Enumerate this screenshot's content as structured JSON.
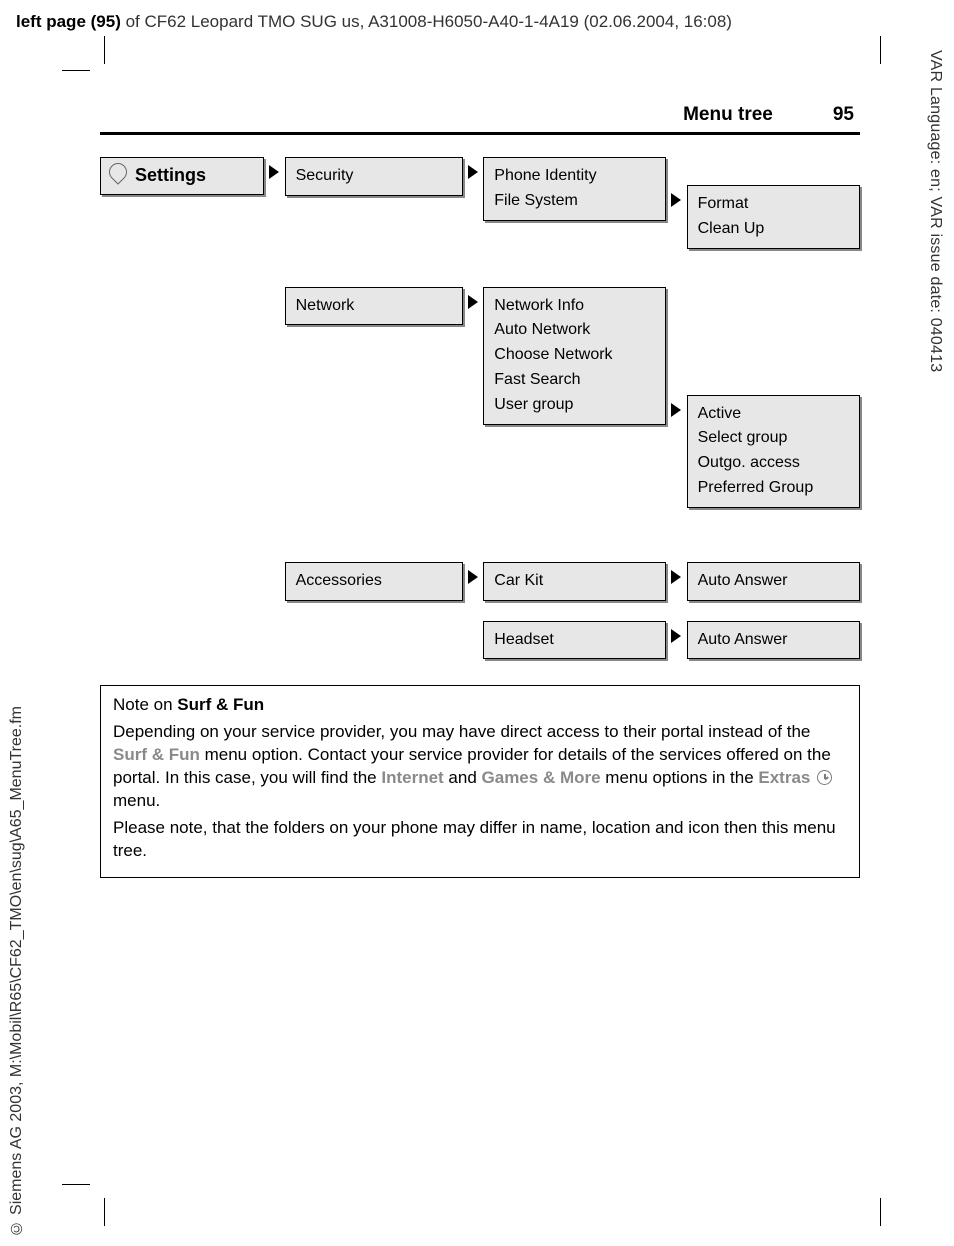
{
  "header": {
    "prefix": "left page (95)",
    "rest": " of CF62 Leopard TMO SUG us, A31008-H6050-A40-1-4A19 (02.06.2004, 16:08)"
  },
  "side_right": "VAR Language: en; VAR issue date: 040413",
  "side_left": "© Siemens AG 2003, M:\\Mobil\\R65\\CF62_TMO\\en\\sug\\A65_MenuTree.fm",
  "running_head": {
    "title": "Menu tree",
    "page": "95"
  },
  "tree": {
    "root": "Settings",
    "security": {
      "label": "Security",
      "children": {
        "phone_identity": "Phone Identity",
        "file_system": "File System"
      },
      "file_system_children": {
        "format": "Format",
        "clean_up": "Clean Up"
      }
    },
    "network": {
      "label": "Network",
      "children": {
        "network_info": "Network Info",
        "auto_network": "Auto Network",
        "choose_network": "Choose Network",
        "fast_search": "Fast Search",
        "user_group": "User group"
      },
      "user_group_children": {
        "active": "Active",
        "select_group": "Select group",
        "outgo_access": "Outgo. access",
        "preferred_group": "Preferred Group"
      }
    },
    "accessories": {
      "label": "Accessories",
      "car_kit": "Car Kit",
      "headset": "Headset",
      "car_kit_children": {
        "auto_answer": "Auto Answer"
      },
      "headset_children": {
        "auto_answer": "Auto Answer"
      }
    }
  },
  "note": {
    "title_prefix": "Note on ",
    "title_bold": "Surf & Fun",
    "p1a": "Depending on your service provider, you may have direct access to their portal instead of the ",
    "p1b": "Surf & Fun",
    "p1c": " menu option. Contact your service provider for details of the services offered on the portal. In this case, you will find the ",
    "p1d": "Internet",
    "p1e": " and ",
    "p1f": "Games & More",
    "p1g": " menu options in the ",
    "p1h": "Extras",
    "p1i": " menu.",
    "p2": "Please note, that the folders on your phone may differ in name, location and icon then this menu tree."
  }
}
